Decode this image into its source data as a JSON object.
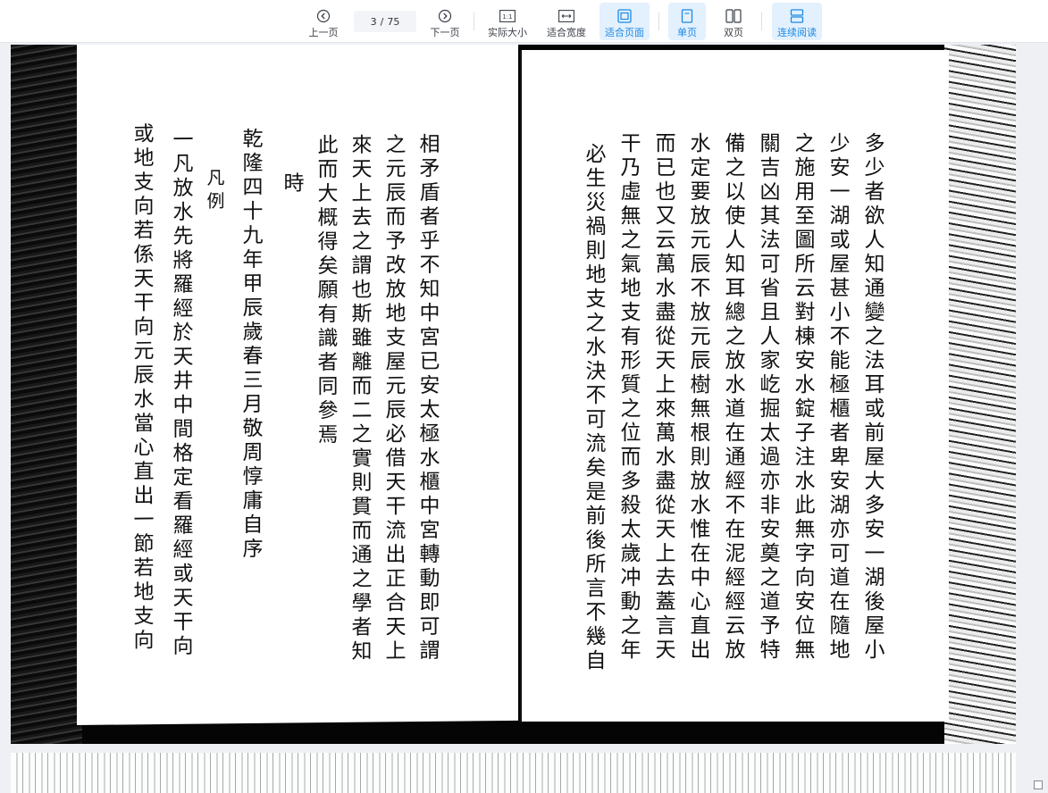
{
  "toolbar": {
    "prev_label": "上一页",
    "page_current": "3",
    "page_separator": "/",
    "page_total": "75",
    "next_label": "下一页",
    "actual_size_label": "实际大小",
    "actual_size_glyph": "1:1",
    "fit_width_label": "适合宽度",
    "fit_page_label": "适合页面",
    "single_page_label": "单页",
    "double_page_label": "双页",
    "continuous_label": "连续阅读",
    "accent_color": "#1a8ae6"
  },
  "document": {
    "right_page_columns": [
      "多少者欲人知通變之法耳或前屋大多安一湖後屋小",
      "少安一湖或屋甚小不能極櫃者卑安湖亦可道在隨地",
      "之施用至圖所云對棟安水錠子注水此無字向安位無",
      "關吉凶其法可省且人家屹掘太過亦非安奠之道予特",
      "備之以使人知耳總之放水道在通經不在泥經經云放",
      "水定要放元辰不放元辰樹無根則放水惟在中心直出",
      "而已也又云萬水盡從天上來萬水盡從天上去蓋言天",
      "干乃虛無之氣地支有形質之位而多殺太歲冲動之年",
      "必生災禍則地支之水決不可流矣是前後所言不幾自"
    ],
    "left_page_columns": [
      "相矛盾者乎不知中宮已安太極水櫃中宮轉動即可謂",
      "之元辰而予改放地支屋元辰必借天干流出正合天上",
      "來天上去之謂也斯雖離而二之實則貫而通之學者知",
      "此而大概得矣願有識者同參焉",
      "時",
      "乾隆四十九年甲辰歲春三月敬周惇庸自序",
      "凡例",
      "一凡放水先將羅經於天井中間格定看羅經或天干向",
      "或地支向若係天干向元辰水當心直出一節若地支向"
    ]
  }
}
